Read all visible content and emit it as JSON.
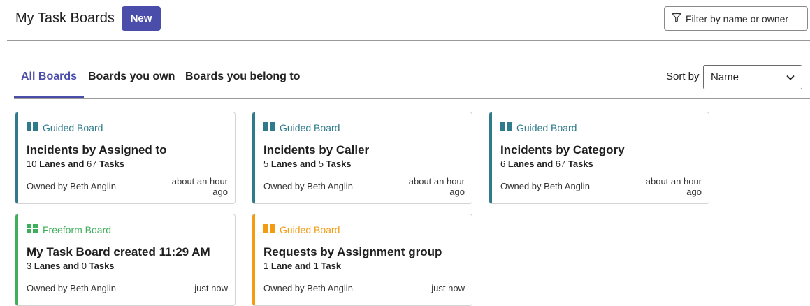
{
  "header": {
    "title": "My Task Boards",
    "new_label": "New",
    "filter_label": "Filter by name or owner"
  },
  "tabs": [
    {
      "label": "All Boards",
      "active": true
    },
    {
      "label": "Boards you own",
      "active": false
    },
    {
      "label": "Boards you belong to",
      "active": false
    }
  ],
  "sort": {
    "label": "Sort by",
    "selected": "Name"
  },
  "colors": {
    "accent": "#4b4dab",
    "guided": "#2f7b8c",
    "freeform": "#3fae5a",
    "guided_alt": "#f39c12"
  },
  "cards": [
    {
      "type": "Guided Board",
      "icon": "guided-board-icon",
      "color": "#2f7b8c",
      "title": "Incidents by Assigned to",
      "lanes_num": "10",
      "lanes_word": "Lanes and",
      "tasks_num": "67",
      "tasks_word": "Tasks",
      "owner": "Owned by Beth Anglin",
      "time_line1": "about an hour",
      "time_line2": "ago"
    },
    {
      "type": "Guided Board",
      "icon": "guided-board-icon",
      "color": "#2f7b8c",
      "title": "Incidents by Caller",
      "lanes_num": "5",
      "lanes_word": "Lanes and",
      "tasks_num": "5",
      "tasks_word": "Tasks",
      "owner": "Owned by Beth Anglin",
      "time_line1": "about an hour",
      "time_line2": "ago"
    },
    {
      "type": "Guided Board",
      "icon": "guided-board-icon",
      "color": "#2f7b8c",
      "title": "Incidents by Category",
      "lanes_num": "6",
      "lanes_word": "Lanes and",
      "tasks_num": "67",
      "tasks_word": "Tasks",
      "owner": "Owned by Beth Anglin",
      "time_line1": "about an hour",
      "time_line2": "ago"
    },
    {
      "type": "Freeform Board",
      "icon": "freeform-board-icon",
      "color": "#3fae5a",
      "title": "My Task Board created 11:29 AM",
      "lanes_num": "3",
      "lanes_word": "Lanes and",
      "tasks_num": "0",
      "tasks_word": "Tasks",
      "owner": "Owned by Beth Anglin",
      "time_line1": "just now",
      "time_line2": ""
    },
    {
      "type": "Guided Board",
      "icon": "guided-board-icon",
      "color": "#f39c12",
      "title": "Requests by Assignment group",
      "lanes_num": "1",
      "lanes_word": "Lane and",
      "tasks_num": "1",
      "tasks_word": "Task",
      "owner": "Owned by Beth Anglin",
      "time_line1": "just now",
      "time_line2": ""
    }
  ]
}
